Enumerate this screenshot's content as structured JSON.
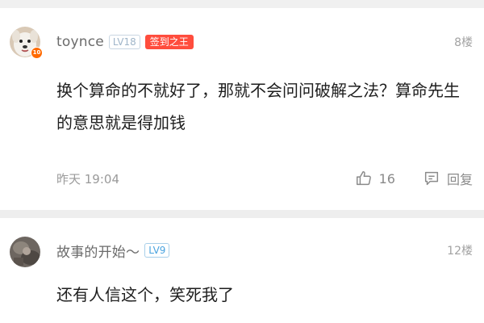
{
  "comments": [
    {
      "username": "toynce",
      "level": "LV18",
      "title_badge": "签到之王",
      "avatar_level": "10",
      "floor": "8楼",
      "text": "换个算命的不就好了，那就不会问问破解之法？算命先生的意思就是得加钱",
      "time": "昨天 19:04",
      "likes": "16",
      "reply_label": "回复"
    },
    {
      "username": "故事的开始～",
      "level": "LV9",
      "floor": "12楼",
      "text": "还有人信这个，笑死我了"
    }
  ],
  "icons": {
    "like": "thumbs-up-icon",
    "reply": "comment-icon"
  },
  "colors": {
    "title_badge": "#ff4d3d",
    "level_blue": "#4aa3df",
    "avatar_level": "#ff6a00"
  }
}
